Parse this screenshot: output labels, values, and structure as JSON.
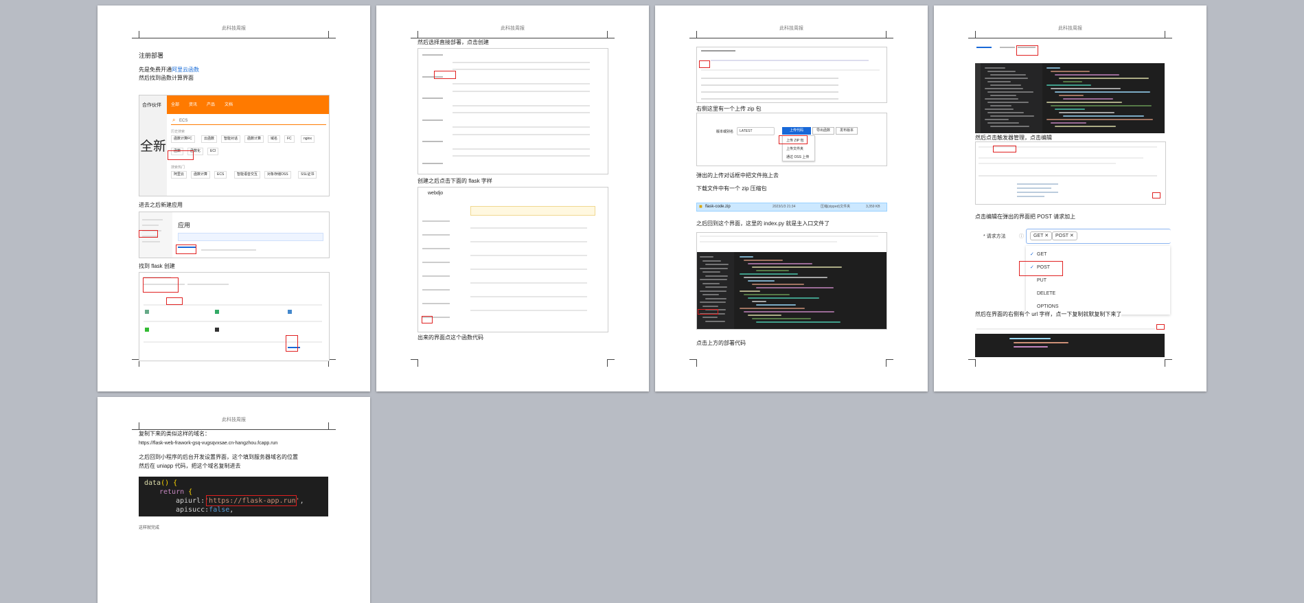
{
  "header_text": "此科技周报",
  "pages": {
    "p1": {
      "heading": "注册部署",
      "line1_prefix": "先是免费开通",
      "line1_link": "阿里云函数",
      "line2": "然后找到函数计算界面",
      "hero_text": "全新",
      "nav_left": "合作伙伴",
      "tabs": [
        "全部",
        "资讯",
        "产品",
        "文档"
      ],
      "search_value": "ECS",
      "history_label": "历史搜索",
      "chips_row1": [
        "函数计算FC",
        "云函数",
        "智能对话",
        "函数计算",
        "域名",
        "FC",
        "nginx"
      ],
      "chips_row2": [
        "函数",
        "函数化",
        "ECI"
      ],
      "hot_label": "搜索热门",
      "chips_row3": [
        "阿里云",
        "函数计算",
        "ECS",
        "智能语音交互",
        "对象存储OSS",
        "SSL证书"
      ],
      "line3": "进去之后新建应用",
      "app_title": "应用",
      "line4": "找到 flask 创建"
    },
    "p2": {
      "line1": "然后选择直接部署，点击创建",
      "line2": "创建之后点击下面的 flask 字样",
      "app_name": "webdjo",
      "line3": "出来的界面点这个函数代码"
    },
    "p3": {
      "line1": "右侧这里有一个上传 zip 包",
      "version_label": "版本或别名",
      "version_value": "LATEST",
      "upload_button": "上传代码",
      "upload_menu": [
        "上传 ZIP 包",
        "上传文件夹",
        "通过 OSS 上传"
      ],
      "export_button": "导出函数",
      "publish_button": "发布版本",
      "line2": "弹出的上传对话框中把文件拖上去",
      "line3": "下载文件中有一个 zip 压缩包",
      "file_name": "flask-code.zip",
      "file_date": "2023/1/3 21:34",
      "file_type": "压缩(zipped)文件夹",
      "file_size": "3,359 KB",
      "line4": "之后回到这个界面，这里的 index.py 就是主入口文件了",
      "line5": "点击上方的部署代码"
    },
    "p4": {
      "line1": "然后点击触发器管理，点击编辑",
      "line2": "点击编辑在弹出的界面把 POST 请求加上",
      "method_label": "* 请求方法",
      "selected": [
        "GET",
        "POST"
      ],
      "options": [
        "GET",
        "POST",
        "PUT",
        "DELETE",
        "OPTIONS"
      ],
      "line3": "然后在界面的右侧有个 url 字样，点一下复制就默复制下来了"
    },
    "p5": {
      "line1": "复制下来的类似这样的域名：",
      "url": "https://flask-web-frawork-gsq-vugsqvxsae.cn-hangzhou.fcapp.run",
      "line2": "之后回到小程序的后台开发设置界面，这个填到服务器域名的位置",
      "line3": "然后在 uniapp 代码，把这个域名复制进去",
      "code_fn": "data",
      "code_return": "return",
      "code_key": "apiurl:",
      "code_url": "'https://flask-app.run'",
      "code_key2": "apisucc:",
      "code_false": "false",
      "footer_note": "这样就完成"
    }
  },
  "colors": {
    "accent_red": "#e02020",
    "orange": "#ff7a00",
    "blue": "#1868d8",
    "code_bg": "#1e1e1e"
  }
}
